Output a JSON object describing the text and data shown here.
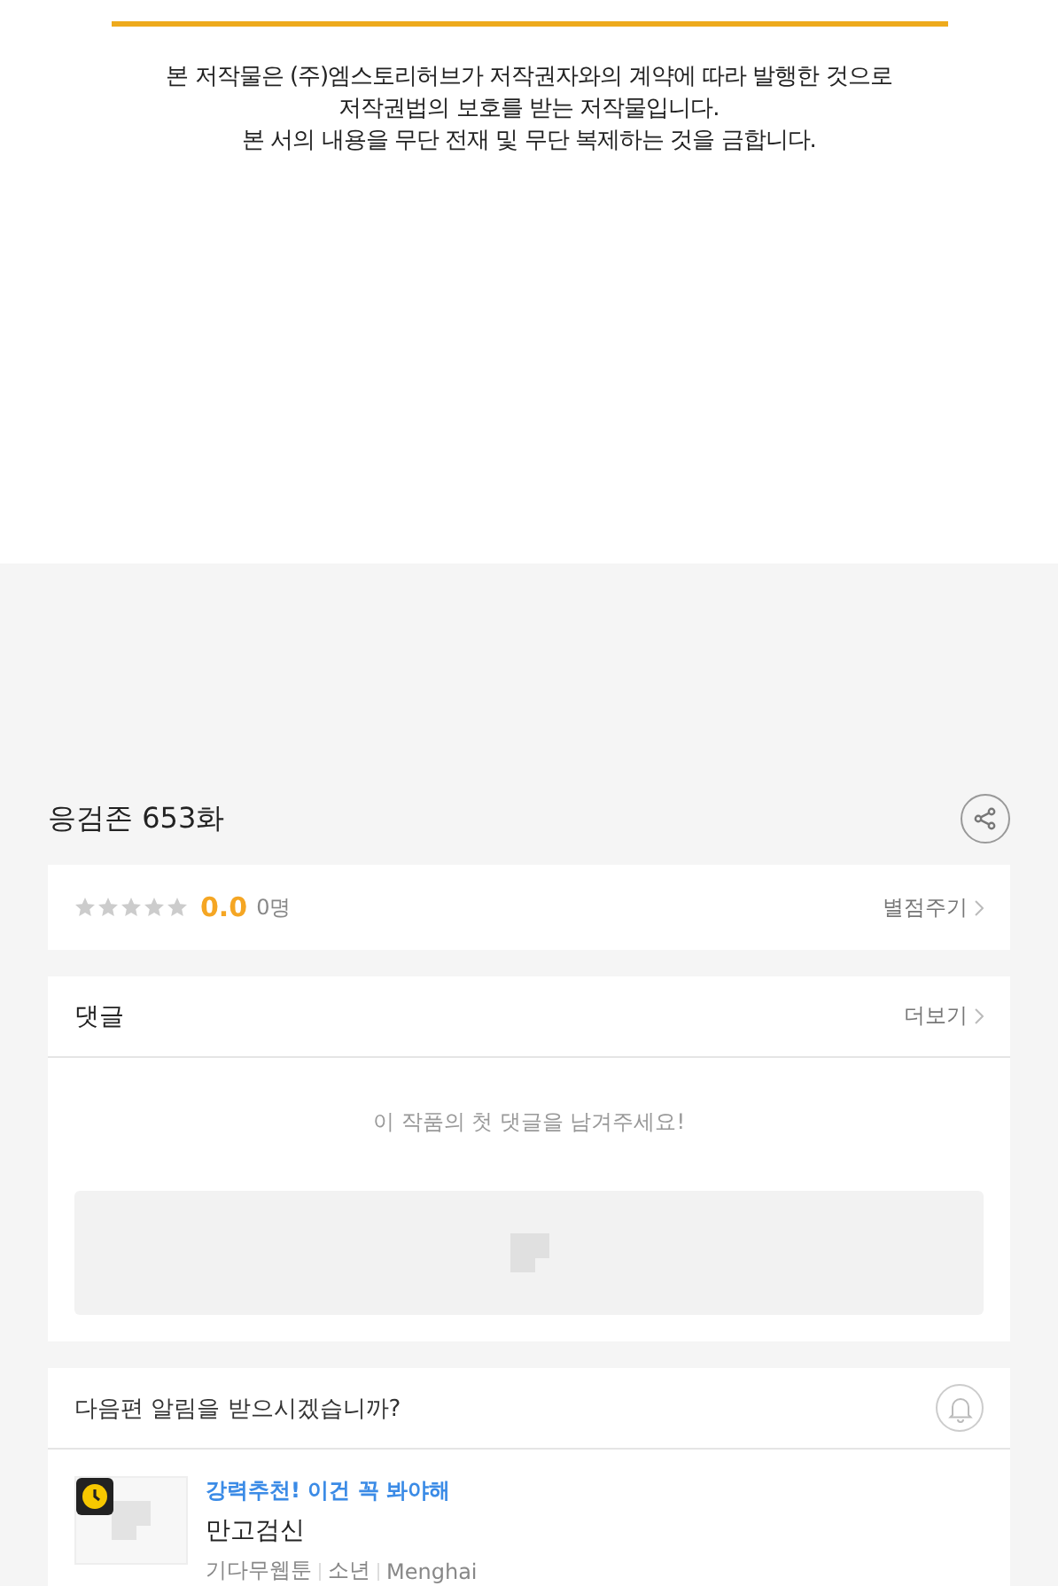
{
  "notice": {
    "lines": [
      "본 저작물은 (주)엠스토리허브가 저작권자와의 계약에 따라 발행한 것으로",
      "저작권법의 보호를 받는 저작물입니다.",
      "본 서의 내용을 무단 전재 및 무단 복제하는 것을 금합니다."
    ]
  },
  "episode_title": "응검존 653화",
  "rating": {
    "stars": 0,
    "score": "0.0",
    "count": "0명",
    "action": "별점주기"
  },
  "comments": {
    "title": "댓글",
    "more": "더보기",
    "empty_message": "이 작품의 첫 댓글을 남겨주세요!"
  },
  "notification": {
    "question": "다음편 알림을 받으시겠습니까?"
  },
  "recommendation": {
    "tagline": "강력추천! 이건 꼭 봐야해",
    "title": "만고검신",
    "meta": [
      "기다무웹툰",
      "소년",
      "Menghai"
    ]
  }
}
